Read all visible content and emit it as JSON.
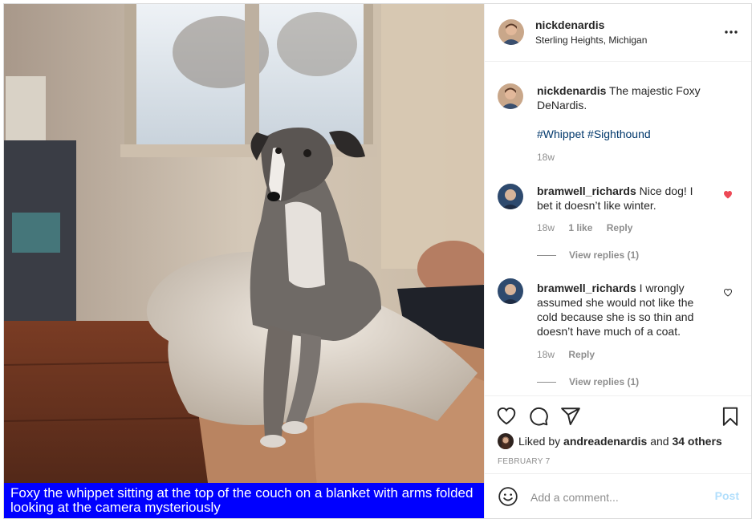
{
  "post": {
    "image_caption": "Foxy the whippet sitting at the top of the couch on a blanket with arms folded looking at the camera mysteriously"
  },
  "header": {
    "username": "nickdenardis",
    "location": "Sterling Heights, Michigan",
    "more_icon": "more-options-icon"
  },
  "comments": [
    {
      "username": "nickdenardis",
      "text": "The majestic Foxy DeNardis.",
      "tags": "#Whippet #Sighthound",
      "time": "18w"
    },
    {
      "username": "bramwell_richards",
      "text": "Nice dog! I bet it doesn’t like winter.",
      "time": "18w",
      "likes": "1 like",
      "reply": "Reply",
      "view_replies": "View replies (1)",
      "liked": true
    },
    {
      "username": "bramwell_richards",
      "text": "I wrongly assumed she would not like the cold because she is so thin and doesn’t have much of a coat.",
      "time": "18w",
      "reply": "Reply",
      "view_replies": "View replies (1)",
      "liked": false
    }
  ],
  "actions": {
    "liked_by_prefix": "Liked by",
    "liked_by_user": "andreadenardis",
    "liked_by_and": "and",
    "liked_by_others": "34 others",
    "date": "FEBRUARY 7"
  },
  "add_comment": {
    "placeholder": "Add a comment...",
    "post_label": "Post"
  },
  "colors": {
    "caption_bg": "#0000ff",
    "heart_liked": "#ed4956",
    "hashtag": "#00376b",
    "post_disabled": "#b2dffc"
  }
}
